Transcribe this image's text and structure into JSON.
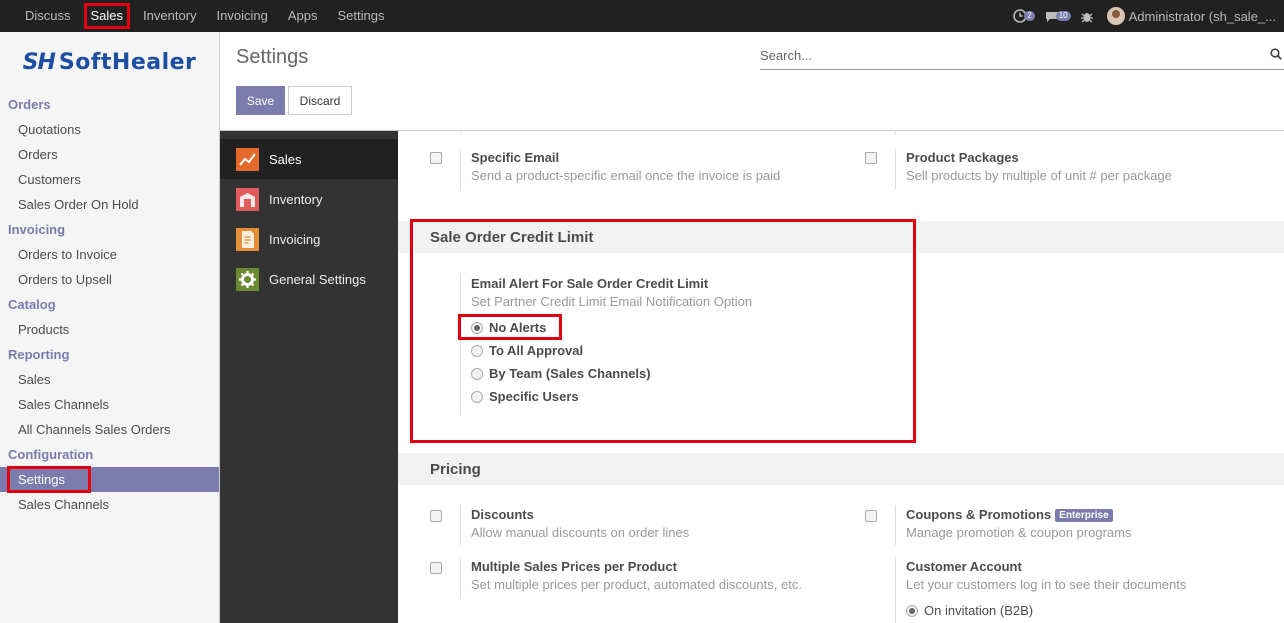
{
  "topbar": {
    "menu": [
      "Discuss",
      "Sales",
      "Inventory",
      "Invoicing",
      "Apps",
      "Settings"
    ],
    "active": "Sales",
    "activity_count": "2",
    "message_count": "10",
    "user": "Administrator (sh_sale_..."
  },
  "brand": {
    "mark": "SH",
    "word": "SoftHealer"
  },
  "sidebar": {
    "sections": [
      {
        "title": "Orders",
        "items": [
          "Quotations",
          "Orders",
          "Customers",
          "Sales Order On Hold"
        ]
      },
      {
        "title": "Invoicing",
        "items": [
          "Orders to Invoice",
          "Orders to Upsell"
        ]
      },
      {
        "title": "Catalog",
        "items": [
          "Products"
        ]
      },
      {
        "title": "Reporting",
        "items": [
          "Sales",
          "Sales Channels",
          "All Channels Sales Orders"
        ]
      },
      {
        "title": "Configuration",
        "items": [
          "Settings",
          "Sales Channels"
        ]
      }
    ]
  },
  "control_panel": {
    "title": "Settings",
    "search_placeholder": "Search...",
    "save_label": "Save",
    "discard_label": "Discard"
  },
  "apps_nav": [
    "Sales",
    "Inventory",
    "Invoicing",
    "General Settings"
  ],
  "settings": {
    "specific_email": {
      "label": "Specific Email",
      "desc": "Send a product-specific email once the invoice is paid",
      "checked": false
    },
    "product_packages": {
      "label": "Product Packages",
      "desc": "Sell products by multiple of unit # per package",
      "checked": false
    },
    "credit_limit": {
      "section": "Sale Order Credit Limit",
      "label": "Email Alert For Sale Order Credit Limit",
      "desc": "Set Partner Credit Limit Email Notification Option",
      "options": [
        "No Alerts",
        "To All Approval",
        "By Team (Sales Channels)",
        "Specific Users"
      ],
      "selected": "No Alerts"
    },
    "pricing_section": "Pricing",
    "discounts": {
      "label": "Discounts",
      "desc": "Allow manual discounts on order lines",
      "checked": false
    },
    "coupons": {
      "label": "Coupons & Promotions",
      "badge": "Enterprise",
      "desc": "Manage promotion & coupon programs",
      "checked": false
    },
    "multi_prices": {
      "label": "Multiple Sales Prices per Product",
      "desc": "Set multiple prices per product, automated discounts, etc.",
      "checked": false
    },
    "customer_account": {
      "label": "Customer Account",
      "desc": "Let your customers log in to see their documents",
      "option": "On invitation (B2B)"
    }
  },
  "colors": {
    "accent": "#7c7bad",
    "highlight": "#e3000f",
    "topbar": "#212121",
    "apps_nav": "#333333"
  }
}
